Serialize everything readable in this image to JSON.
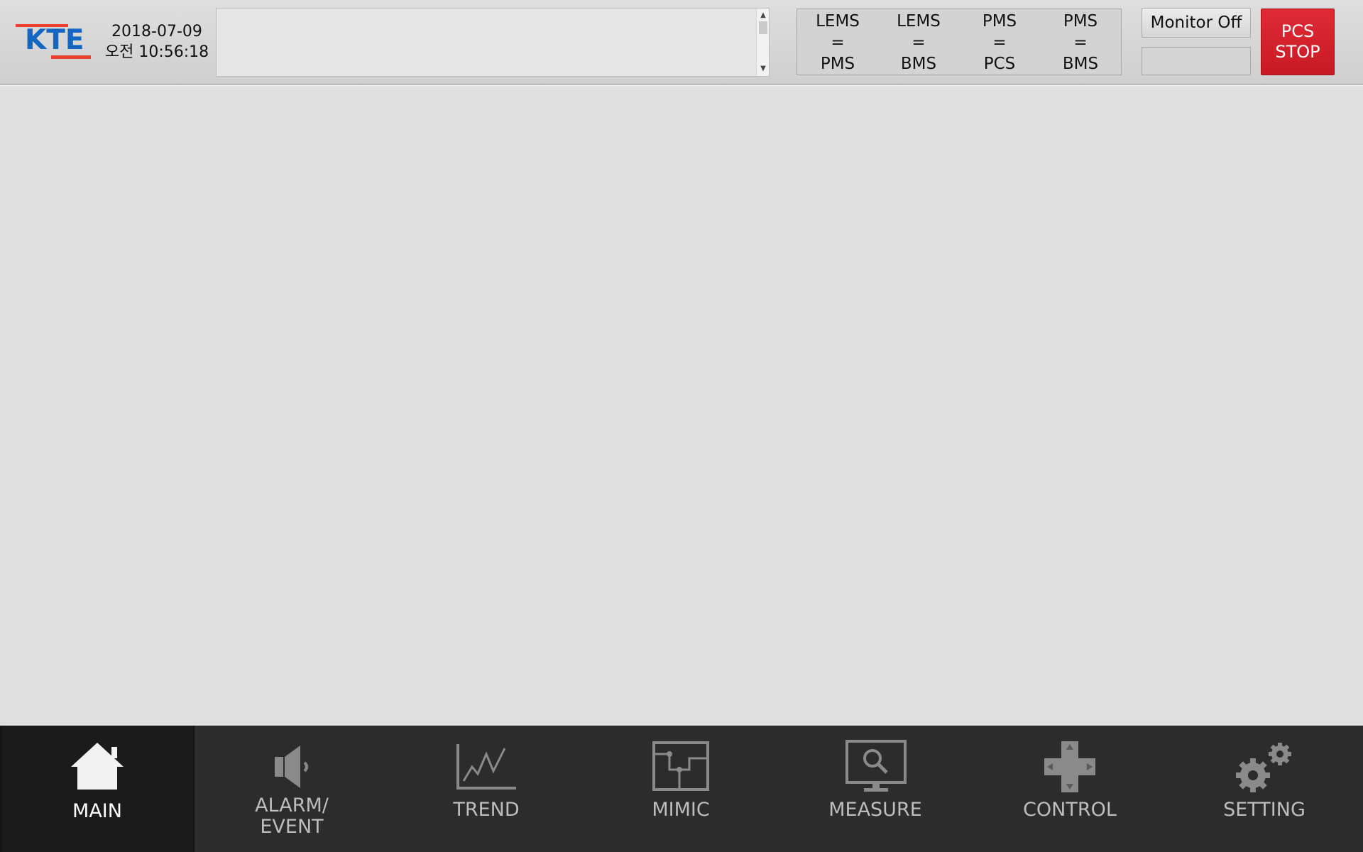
{
  "header": {
    "logo_text": "KTE",
    "date": "2018-07-09",
    "time": "오전 10:56:18",
    "comm_status": [
      {
        "top": "LEMS",
        "mid": "=",
        "bottom": "PMS"
      },
      {
        "top": "LEMS",
        "mid": "=",
        "bottom": "BMS"
      },
      {
        "top": "PMS",
        "mid": "=",
        "bottom": "PCS"
      },
      {
        "top": "PMS",
        "mid": "=",
        "bottom": "BMS"
      }
    ],
    "monitor_off_label": "Monitor Off",
    "pcs_stop_line1": "PCS",
    "pcs_stop_line2": "STOP",
    "colors": {
      "logo_blue": "#1566c3",
      "logo_red": "#e8412c",
      "stop_red": "#d52029"
    }
  },
  "nav": {
    "items": [
      {
        "label": "MAIN",
        "icon": "home-icon",
        "active": true
      },
      {
        "label_line1": "ALARM/",
        "label_line2": "EVENT",
        "icon": "speaker-icon",
        "active": false
      },
      {
        "label": "TREND",
        "icon": "trend-chart-icon",
        "active": false
      },
      {
        "label": "MIMIC",
        "icon": "mimic-diagram-icon",
        "active": false
      },
      {
        "label": "MEASURE",
        "icon": "monitor-search-icon",
        "active": false
      },
      {
        "label": "CONTROL",
        "icon": "dpad-icon",
        "active": false
      },
      {
        "label": "SETTING",
        "icon": "gears-icon",
        "active": false
      }
    ]
  }
}
